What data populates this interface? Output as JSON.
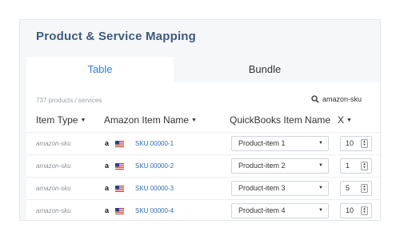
{
  "title": "Product & Service Mapping",
  "tabs": [
    {
      "label": "Table",
      "active": true
    },
    {
      "label": "Bundle",
      "active": false
    }
  ],
  "count_text": "737 products / services",
  "search": {
    "value": "amazon-sku",
    "icon": "search-icon"
  },
  "columns": {
    "type": "Item Type",
    "amazon": "Amazon Item Name",
    "quickbooks": "QuickBooks Item Name",
    "qty": "X"
  },
  "rows": [
    {
      "type": "amazon-sku",
      "amazon_logo": "a",
      "sku": "SKU 00000-1",
      "qb_item": "Product-item 1",
      "qty": "10"
    },
    {
      "type": "amazon-sku",
      "amazon_logo": "a",
      "sku": "SKU 00000-2",
      "qb_item": "Product-item 2",
      "qty": "1"
    },
    {
      "type": "amazon-sku",
      "amazon_logo": "a",
      "sku": "SKU 00000-3",
      "qb_item": "Product-item 3",
      "qty": "5"
    },
    {
      "type": "amazon-sku",
      "amazon_logo": "a",
      "sku": "SKU 00000-4",
      "qb_item": "Product-item 4",
      "qty": "10"
    }
  ],
  "colors": {
    "accent": "#2f80ed",
    "title": "#3d5a80",
    "link": "#2f6fb5"
  }
}
